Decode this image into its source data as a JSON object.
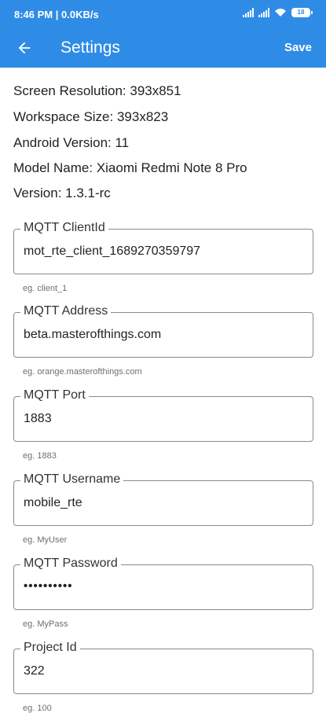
{
  "status_bar": {
    "time_network": "8:46 PM | 0.0KB/s",
    "battery": "18"
  },
  "app_bar": {
    "title": "Settings",
    "save_label": "Save"
  },
  "device_info": {
    "screen_resolution": "Screen Resolution: 393x851",
    "workspace_size": "Workspace Size: 393x823",
    "android_version": "Android Version: 11",
    "model_name": "Model Name: Xiaomi Redmi Note 8 Pro",
    "version": "Version: 1.3.1-rc"
  },
  "fields": {
    "client_id": {
      "label": "MQTT ClientId",
      "value": "mot_rte_client_1689270359797",
      "helper": "eg. client_1"
    },
    "address": {
      "label": "MQTT Address",
      "value": "beta.masterofthings.com",
      "helper": "eg. orange.masterofthings.com"
    },
    "port": {
      "label": "MQTT Port",
      "value": "1883",
      "helper": "eg. 1883"
    },
    "username": {
      "label": "MQTT Username",
      "value": "mobile_rte",
      "helper": "eg. MyUser"
    },
    "password": {
      "label": "MQTT Password",
      "value": "••••••••••",
      "helper": "eg. MyPass"
    },
    "project_id": {
      "label": "Project Id",
      "value": "322",
      "helper": "eg. 100"
    }
  }
}
